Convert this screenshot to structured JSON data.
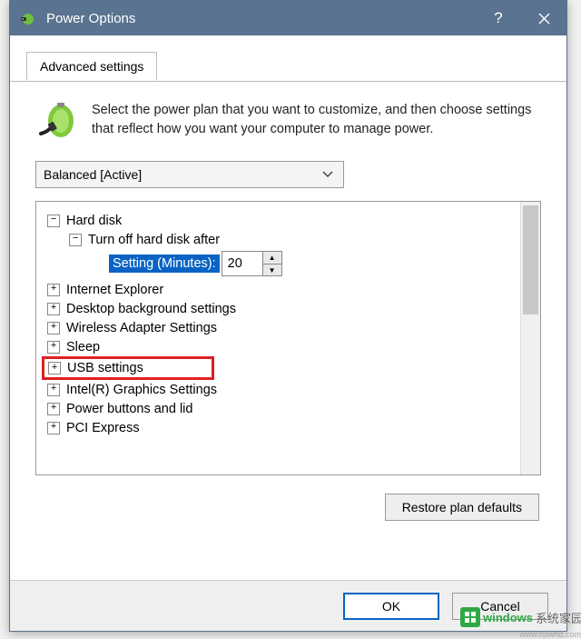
{
  "title": "Power Options",
  "tab": "Advanced settings",
  "header_text": "Select the power plan that you want to customize, and then choose settings that reflect how you want your computer to manage power.",
  "plan": "Balanced [Active]",
  "tree": [
    {
      "label": "Hard disk",
      "expanded": true,
      "children": [
        {
          "label": "Turn off hard disk after",
          "expanded": true,
          "leaf": {
            "setting_label": "Setting (Minutes):",
            "value": "20"
          }
        }
      ]
    },
    {
      "label": "Internet Explorer",
      "expanded": false
    },
    {
      "label": "Desktop background settings",
      "expanded": false
    },
    {
      "label": "Wireless Adapter Settings",
      "expanded": false
    },
    {
      "label": "Sleep",
      "expanded": false
    },
    {
      "label": "USB settings",
      "expanded": false,
      "highlighted": true
    },
    {
      "label": "Intel(R) Graphics Settings",
      "expanded": false
    },
    {
      "label": "Power buttons and lid",
      "expanded": false
    },
    {
      "label": "PCI Express",
      "expanded": false
    }
  ],
  "restore_btn": "Restore plan defaults",
  "ok_btn": "OK",
  "cancel_btn": "Cancel",
  "watermark": {
    "brand1": "windows",
    "brand2": "系统家园",
    "url": "www.ruiwhd.com"
  }
}
